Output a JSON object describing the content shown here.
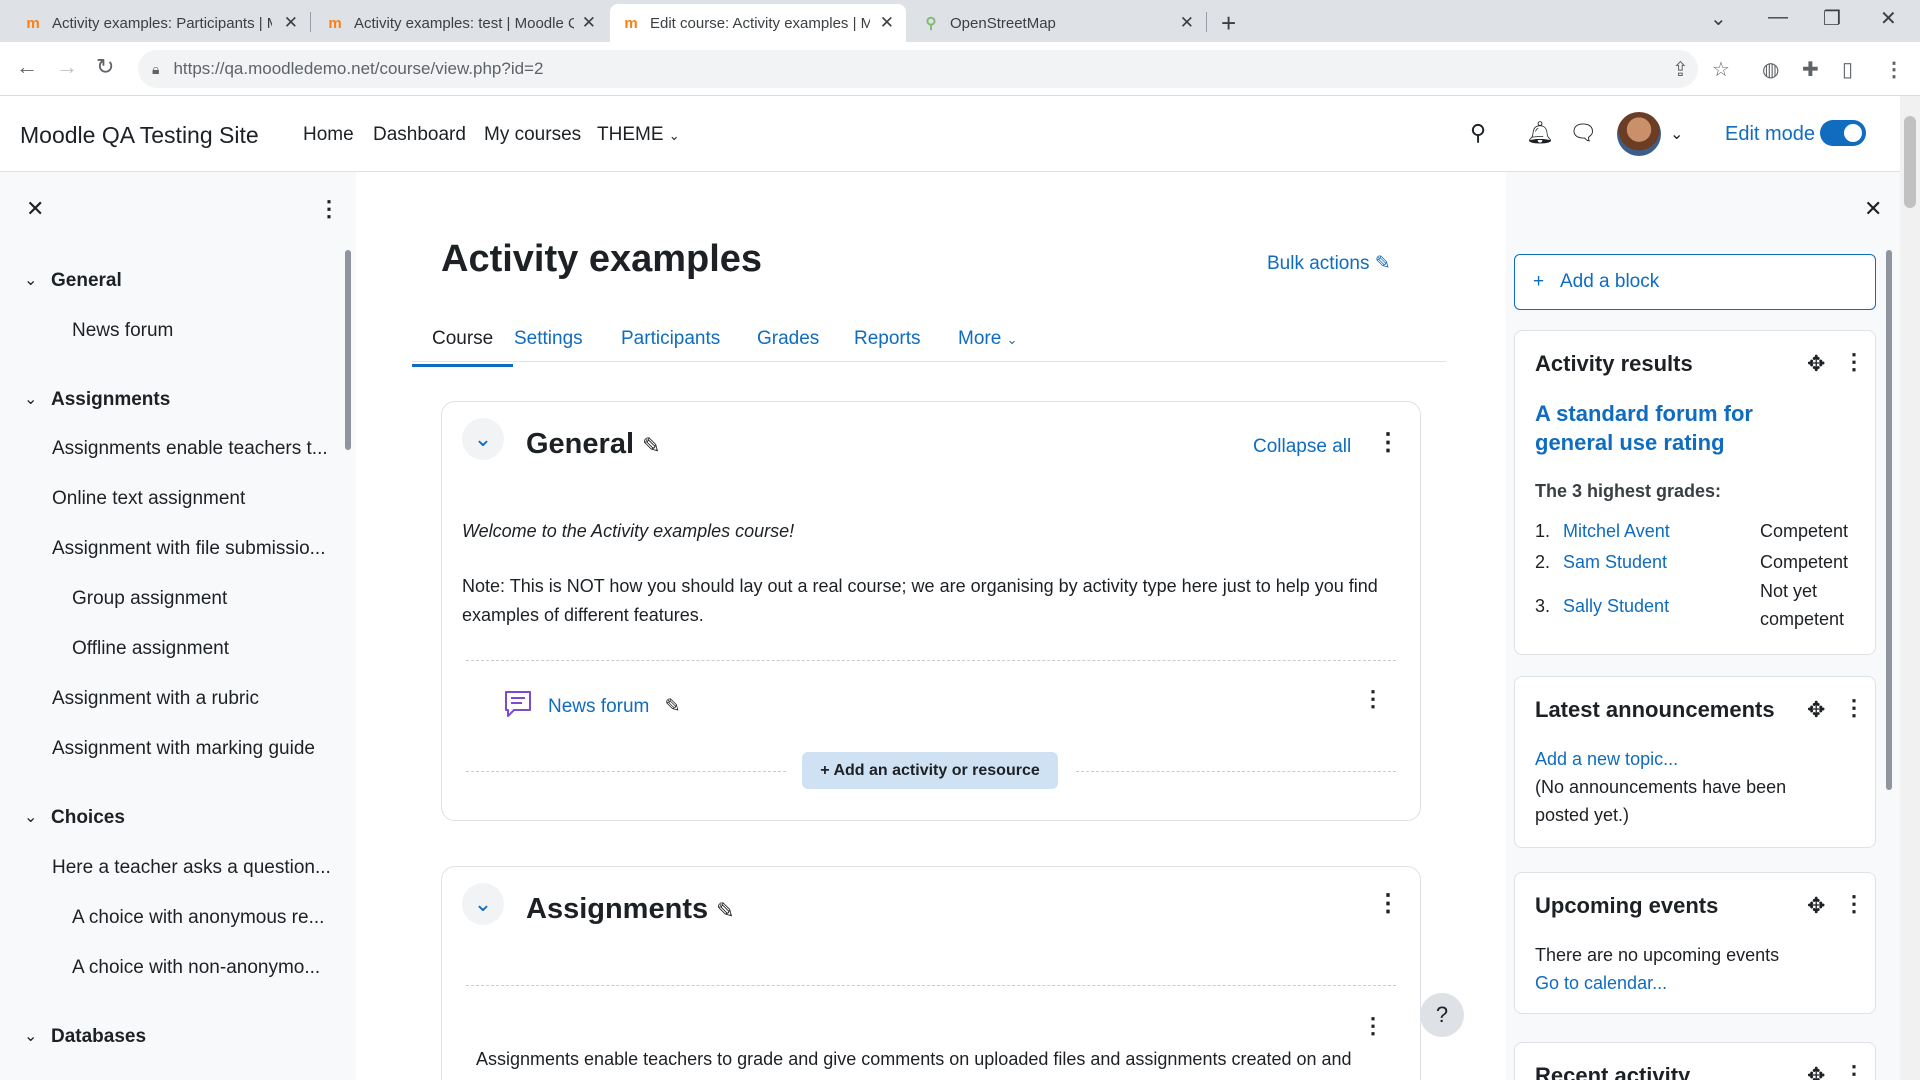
{
  "browser": {
    "tabs": [
      {
        "title": "Activity examples: Participants | M",
        "favicon": "moodle-icon"
      },
      {
        "title": "Activity examples: test | Moodle Q",
        "favicon": "moodle-icon"
      },
      {
        "title": "Edit course: Activity examples | M",
        "favicon": "moodle-icon"
      },
      {
        "title": "OpenStreetMap",
        "favicon": "osm-icon"
      }
    ],
    "url": "https://qa.moodledemo.net/course/view.php?id=2"
  },
  "navbar": {
    "site_name": "Moodle QA Testing Site",
    "links": [
      "Home",
      "Dashboard",
      "My courses",
      "THEME"
    ],
    "edit_mode_label": "Edit mode"
  },
  "course_index": {
    "sections": [
      {
        "label": "General",
        "items": [
          "News forum"
        ]
      },
      {
        "label": "Assignments",
        "items": [
          "Assignments enable teachers t...",
          "Online text assignment",
          "Assignment with file submissio...",
          "Group assignment",
          "Offline assignment",
          "Assignment with a rubric",
          "Assignment with marking guide"
        ]
      },
      {
        "label": "Choices",
        "items": [
          "Here a teacher asks a question...",
          "A choice with anonymous re...",
          "A choice with non-anonymo..."
        ]
      },
      {
        "label": "Databases",
        "items": []
      }
    ]
  },
  "main": {
    "title": "Activity examples",
    "bulk_actions": "Bulk actions",
    "tabs": [
      "Course",
      "Settings",
      "Participants",
      "Grades",
      "Reports",
      "More"
    ],
    "general": {
      "title": "General",
      "collapse_all": "Collapse all",
      "welcome": "Welcome to the Activity examples course!",
      "note": "Note: This is NOT how you should lay out a real course; we are organising by activity type here just to help you find examples of different features.",
      "forum_link": "News forum",
      "add_activity": "Add an activity or resource"
    },
    "assignments": {
      "title": "Assignments",
      "summary": "Assignments enable teachers to grade and give comments on uploaded files and assignments created on and"
    }
  },
  "blocks": {
    "add_block": "Add a block",
    "activity_results": {
      "title": "Activity results",
      "forum_title": "A standard forum for general use rating",
      "subtitle": "The 3 highest grades:",
      "rows": [
        {
          "rank": "1.",
          "name": "Mitchel Avent",
          "grade": "Competent"
        },
        {
          "rank": "2.",
          "name": "Sam Student",
          "grade": "Competent"
        },
        {
          "rank": "3.",
          "name": "Sally Student",
          "grade": "Not yet competent"
        }
      ]
    },
    "announcements": {
      "title": "Latest announcements",
      "add_topic": "Add a new topic...",
      "empty": "(No announcements have been posted yet.)"
    },
    "events": {
      "title": "Upcoming events",
      "empty": "There are no upcoming events",
      "calendar": "Go to calendar..."
    },
    "recent": {
      "title": "Recent activity"
    }
  },
  "colors": {
    "accent": "#0f6cbf",
    "moodle_orange": "#f98012",
    "forum_purple": "#7b4bd1"
  }
}
